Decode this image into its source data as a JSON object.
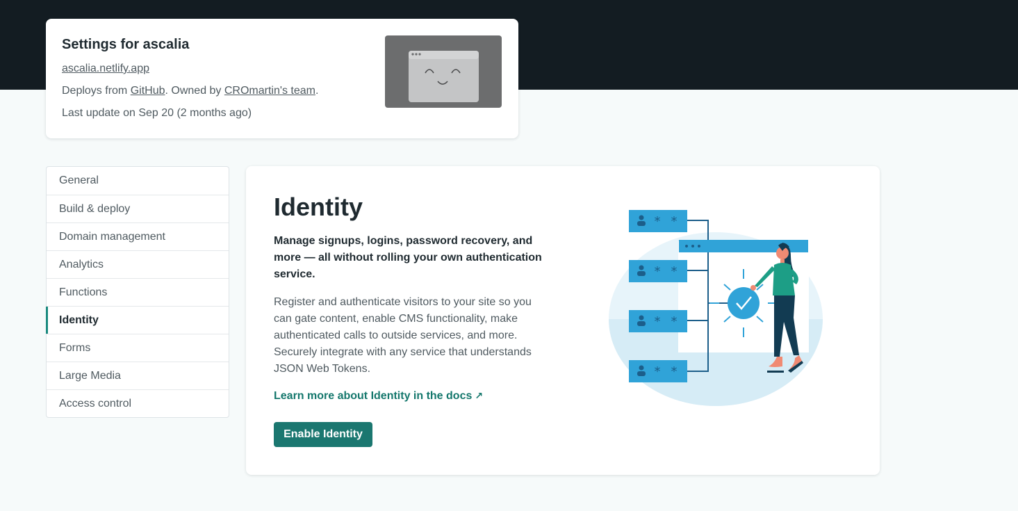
{
  "site": {
    "title": "Settings for ascalia",
    "url": "ascalia.netlify.app",
    "deploys_prefix": "Deploys from ",
    "deploys_source": "GitHub",
    "owned_prefix": ". Owned by ",
    "owner": "CROmartin's team",
    "owned_suffix": ".",
    "last_update": "Last update on Sep 20 (2 months ago)"
  },
  "nav": {
    "items": [
      {
        "label": "General"
      },
      {
        "label": "Build & deploy"
      },
      {
        "label": "Domain management"
      },
      {
        "label": "Analytics"
      },
      {
        "label": "Functions"
      },
      {
        "label": "Identity"
      },
      {
        "label": "Forms"
      },
      {
        "label": "Large Media"
      },
      {
        "label": "Access control"
      }
    ],
    "active": "Identity"
  },
  "identity": {
    "title": "Identity",
    "lead": "Manage signups, logins, password recovery, and more — all without rolling your own authentication service.",
    "description": "Register and authenticate visitors to your site so you can gate content, enable CMS functionality, make authenticated calls to outside services, and more. Securely integrate with any service that understands JSON Web Tokens.",
    "docs_link": "Learn more about Identity in the docs",
    "docs_link_icon": "↗",
    "enable_button": "Enable Identity"
  },
  "colors": {
    "header_band": "#131c22",
    "accent": "#1b7770",
    "link": "#14776c",
    "illustration_blue": "#30a3d8"
  }
}
